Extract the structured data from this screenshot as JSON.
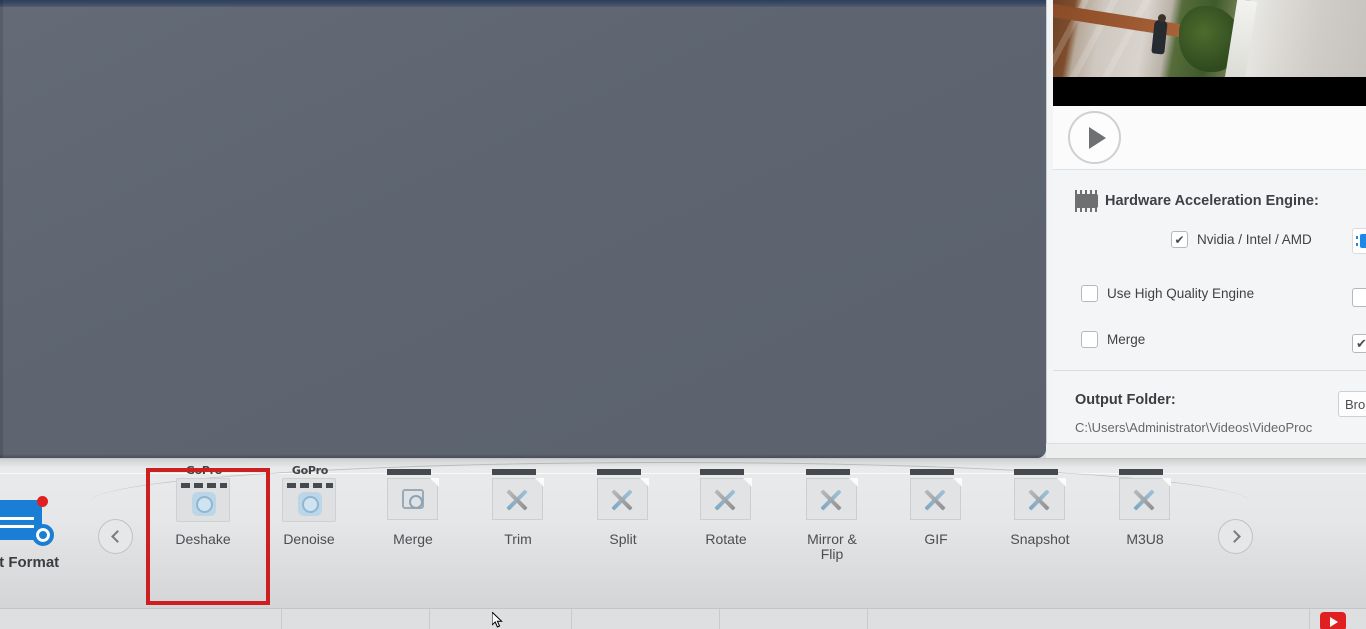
{
  "canvas": {
    "name": "video-preview-canvas"
  },
  "right_panel": {
    "play_button_label": "play",
    "hardware": {
      "icon": "chip-icon",
      "title": "Hardware Acceleration Engine:",
      "options": [
        {
          "label": "Nvidia / Intel / AMD",
          "checked": true
        },
        {
          "label": "Use High Quality Engine",
          "checked": false
        },
        {
          "label": "Merge",
          "checked": false
        }
      ],
      "right_column": [
        {
          "type": "gpu-badge",
          "checked": true
        },
        {
          "type": "checkbox",
          "checked": false
        },
        {
          "type": "checkbox",
          "checked": true
        }
      ]
    },
    "output": {
      "title": "Output Folder:",
      "path": "C:\\Users\\Administrator\\Videos\\VideoProc",
      "browse_label": "Bro"
    }
  },
  "toolbar": {
    "prev_label": "‹",
    "next_label": "›",
    "format_item": {
      "label": "et Format",
      "icon": "target-format-icon"
    },
    "items": [
      {
        "label": "Deshake",
        "icon": "gopro-icon",
        "selected": true
      },
      {
        "label": "Denoise",
        "icon": "gopro-icon",
        "selected": false
      },
      {
        "label": "Merge",
        "icon": "merge-icon",
        "selected": false
      },
      {
        "label": "Trim",
        "icon": "tools-icon",
        "selected": false
      },
      {
        "label": "Split",
        "icon": "tools-icon",
        "selected": false
      },
      {
        "label": "Rotate",
        "icon": "tools-icon",
        "selected": false
      },
      {
        "label": "Mirror &\nFlip",
        "icon": "tools-icon",
        "selected": false
      },
      {
        "label": "GIF",
        "icon": "tools-icon",
        "selected": false
      },
      {
        "label": "Snapshot",
        "icon": "tools-icon",
        "selected": false
      },
      {
        "label": "M3U8",
        "icon": "tools-icon",
        "selected": false
      }
    ],
    "gopro_wordmark": "GoPro"
  },
  "colors": {
    "canvas_bg": "#5f6672",
    "panel_bg": "#f3f4f5",
    "toolbar_bg": "#e6e7e8",
    "highlight_red": "#cc1f1f",
    "accent_blue": "#1a7fd4",
    "youtube_red": "#e02020"
  }
}
